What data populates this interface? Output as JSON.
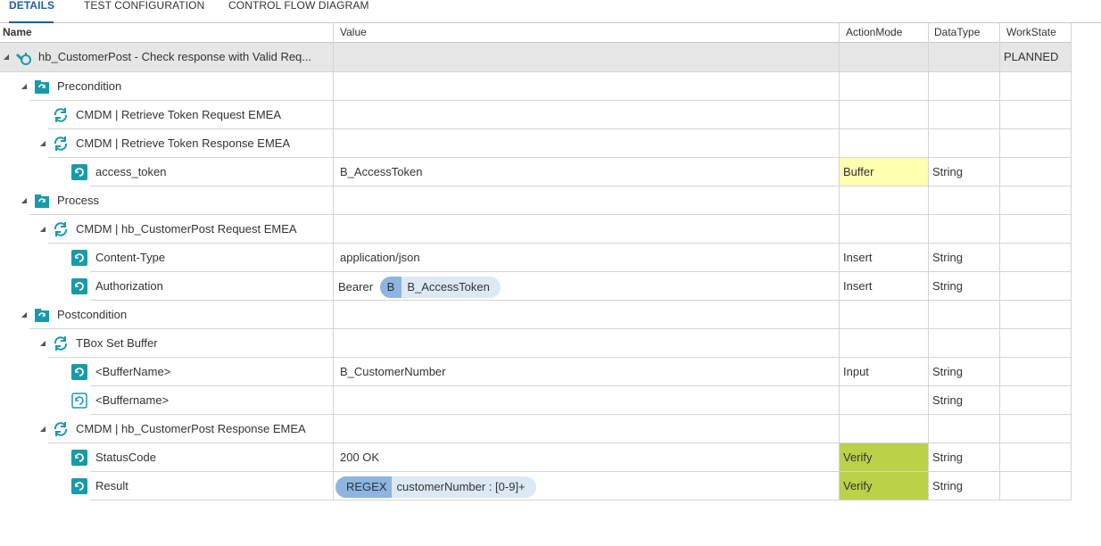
{
  "tabs": [
    "DETAILS",
    "TEST CONFIGURATION",
    "CONTROL FLOW DIAGRAM"
  ],
  "columns": {
    "name": "Name",
    "value": "Value",
    "action": "ActionMode",
    "dtype": "DataType",
    "wstate": "WorkState"
  },
  "rows": [
    {
      "name": "hb_CustomerPost - Check response with Valid Req...",
      "value": "",
      "action": "",
      "dtype": "",
      "wstate": "PLANNED"
    },
    {
      "name": "Precondition",
      "value": "",
      "action": "",
      "dtype": "",
      "wstate": ""
    },
    {
      "name": "CMDM | Retrieve Token Request EMEA",
      "value": "",
      "action": "",
      "dtype": "",
      "wstate": ""
    },
    {
      "name": "CMDM | Retrieve Token Response EMEA",
      "value": "",
      "action": "",
      "dtype": "",
      "wstate": ""
    },
    {
      "name": "access_token",
      "value": "B_AccessToken",
      "action": "Buffer",
      "dtype": "String",
      "wstate": ""
    },
    {
      "name": "Process",
      "value": "",
      "action": "",
      "dtype": "",
      "wstate": ""
    },
    {
      "name": "CMDM | hb_CustomerPost Request EMEA",
      "value": "",
      "action": "",
      "dtype": "",
      "wstate": ""
    },
    {
      "name": "Content-Type",
      "value": "application/json",
      "action": "Insert",
      "dtype": "String",
      "wstate": ""
    },
    {
      "name": "Authorization",
      "value_prefix": "Bearer",
      "chip_tag": "B",
      "chip_text": "B_AccessToken",
      "action": "Insert",
      "dtype": "String",
      "wstate": ""
    },
    {
      "name": "Postcondition",
      "value": "",
      "action": "",
      "dtype": "",
      "wstate": ""
    },
    {
      "name": "TBox Set Buffer",
      "value": "",
      "action": "",
      "dtype": "",
      "wstate": ""
    },
    {
      "name": "<BufferName>",
      "value": "B_CustomerNumber",
      "action": "Input",
      "dtype": "String",
      "wstate": ""
    },
    {
      "name": "<Buffername>",
      "value": "",
      "action": "",
      "dtype": "String",
      "wstate": ""
    },
    {
      "name": "CMDM | hb_CustomerPost Response EMEA",
      "value": "",
      "action": "",
      "dtype": "",
      "wstate": ""
    },
    {
      "name": "StatusCode",
      "value": "200 OK",
      "action": "Verify",
      "dtype": "String",
      "wstate": ""
    },
    {
      "name": "Result",
      "chip_tag": "REGEX",
      "chip_text": "customerNumber : [0-9]+",
      "action": "Verify",
      "dtype": "String",
      "wstate": ""
    }
  ],
  "colors": {
    "accent": "#1f5f9e",
    "buffer_bg": "#ffffb0",
    "verify_bg": "#bcd14a",
    "teal_icon": "#1a9aa8",
    "chip_tag_bg": "#8fb5de",
    "chip_bg": "#dce9f5"
  }
}
